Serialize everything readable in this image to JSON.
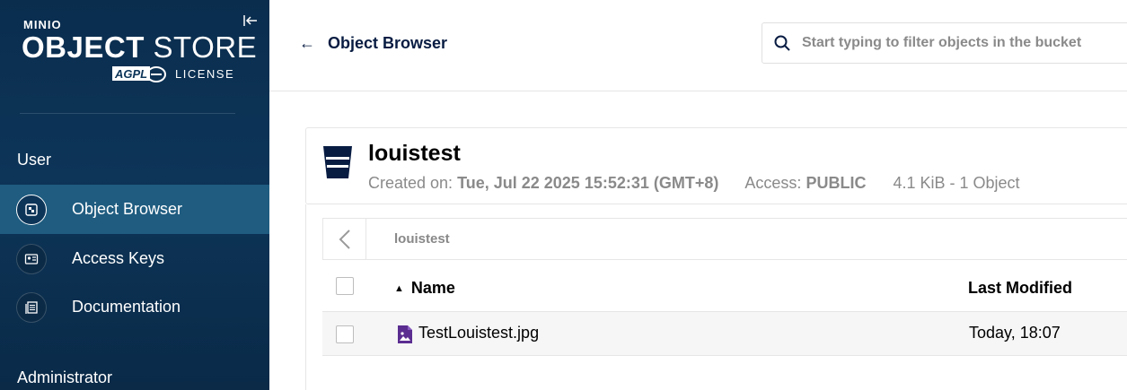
{
  "brand": {
    "logo_text": "MINIO",
    "product_bold": "OBJECT",
    "product_thin": "STORE",
    "badge_text": "AGPL",
    "license_label": "LICENSE"
  },
  "sidebar": {
    "section_user": "User",
    "items": [
      {
        "label": "Object Browser",
        "icon": "bucket-browser-icon",
        "active": true
      },
      {
        "label": "Access Keys",
        "icon": "id-card-icon",
        "active": false
      },
      {
        "label": "Documentation",
        "icon": "document-icon",
        "active": false
      }
    ],
    "section_admin": "Administrator"
  },
  "topbar": {
    "title": "Object Browser",
    "search_placeholder": "Start typing to filter objects in the bucket"
  },
  "bucket": {
    "name": "louistest",
    "created_label": "Created on:",
    "created_value": "Tue, Jul 22 2025 15:52:31 (GMT+8)",
    "access_label": "Access:",
    "access_value": "PUBLIC",
    "size_summary": "4.1 KiB - 1 Object"
  },
  "browser": {
    "path": "louistest",
    "columns": {
      "name": "Name",
      "last_modified": "Last Modified"
    },
    "rows": [
      {
        "name": "TestLouistest.jpg",
        "last_modified": "Today, 18:07",
        "icon": "image-file-icon"
      }
    ]
  },
  "colors": {
    "sidebar_bg": "#0d3558",
    "sidebar_active": "#1f5c80",
    "accent_red": "#c72c48",
    "file_icon": "#5b2d91",
    "title_navy": "#081c42"
  }
}
